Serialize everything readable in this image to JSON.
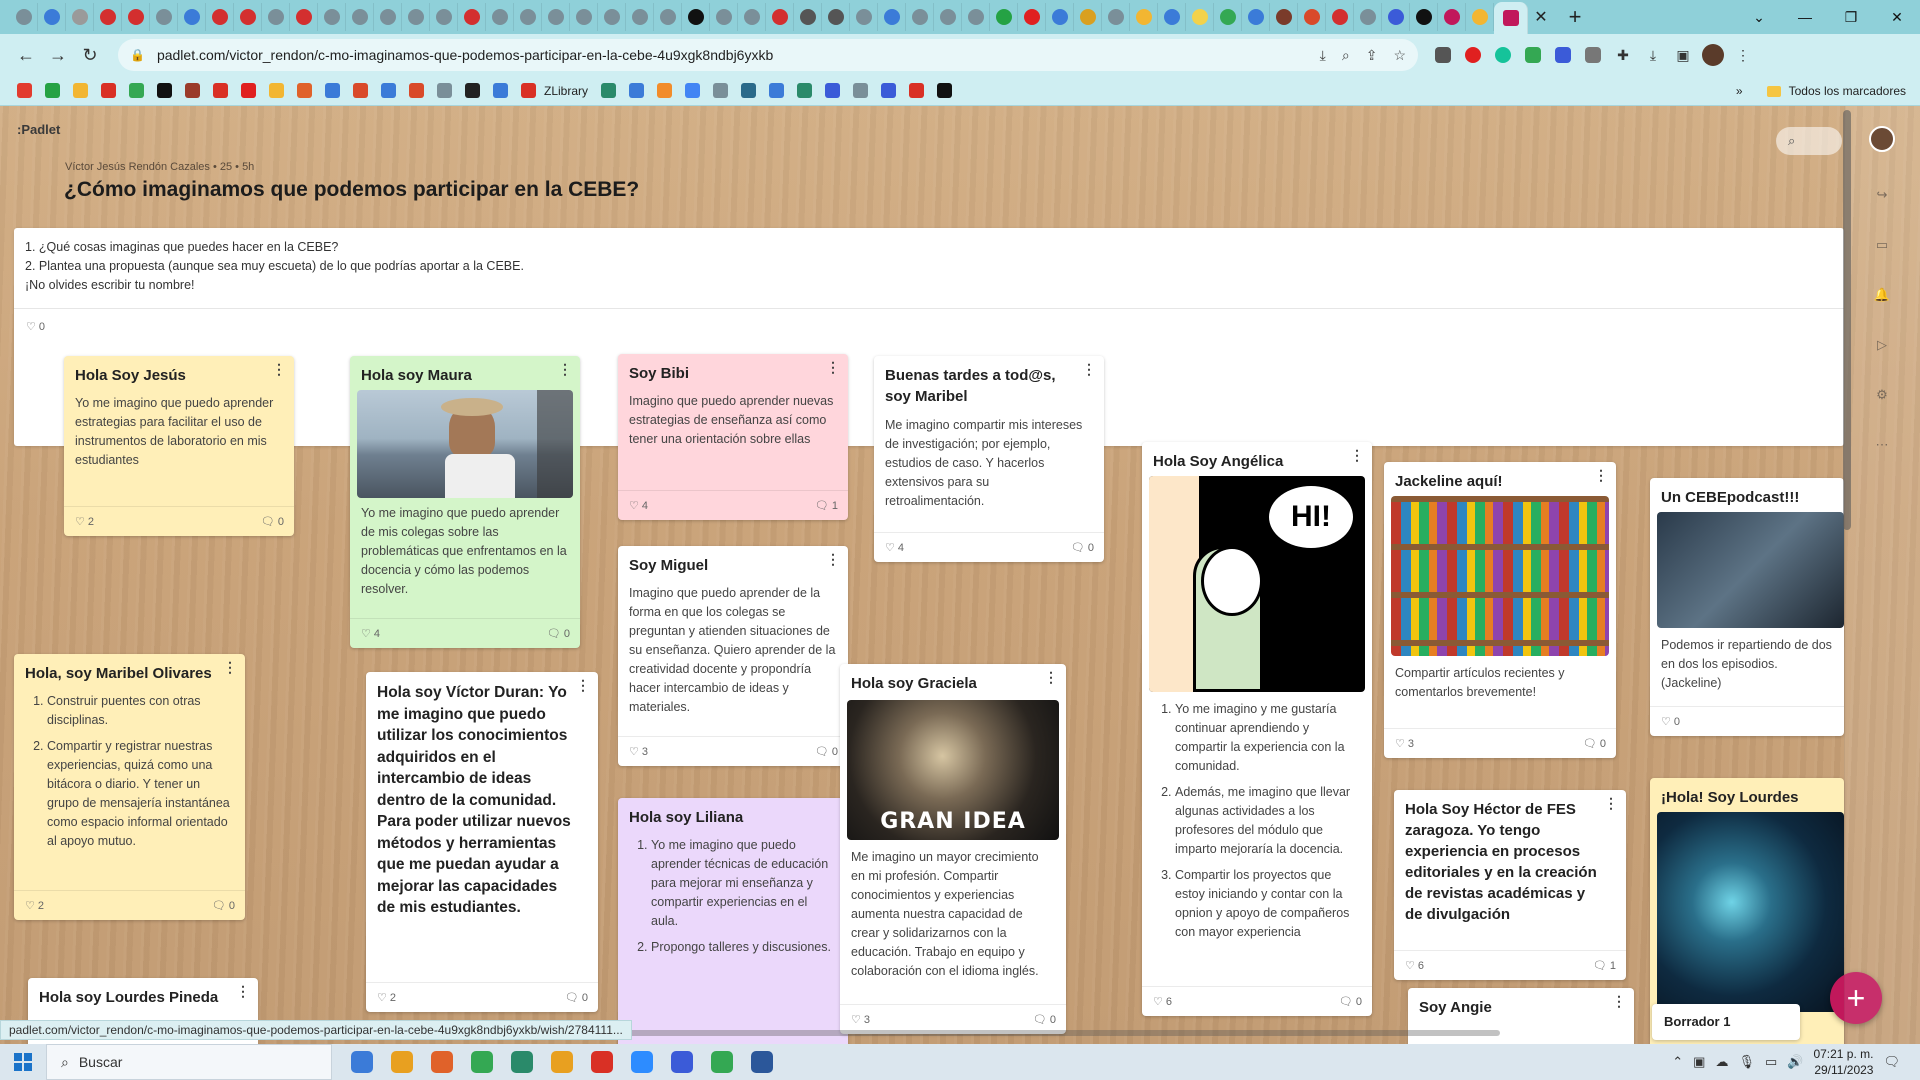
{
  "browser": {
    "url": "padlet.com/victor_rendon/c-mo-imaginamos-que-podemos-participar-en-la-cebe-4u9xgk8ndbj6yxkb",
    "tab_colors": [
      "#7a8f99",
      "#3b7bd8",
      "#9a9a9a",
      "#d32f2f",
      "#d32f2f",
      "#7a8f99",
      "#3b7bd8",
      "#d32f2f",
      "#d32f2f",
      "#7a8f99",
      "#d32f2f",
      "#7a8f99",
      "#7a8f99",
      "#7a8f99",
      "#7a8f99",
      "#7a8f99",
      "#d32f2f",
      "#7a8f99",
      "#7a8f99",
      "#7a8f99",
      "#7a8f99",
      "#7a8f99",
      "#7a8f99",
      "#7a8f99",
      "#111111",
      "#7a8f99",
      "#7a8f99",
      "#d32f2f",
      "#555555",
      "#555555",
      "#7a8f99",
      "#3b7bd8",
      "#7a8f99",
      "#7a8f99",
      "#7a8f99",
      "#25a244",
      "#e02020",
      "#3b7bd8",
      "#d9a020",
      "#7a8f99",
      "#f2b632",
      "#3b7bd8",
      "#f2d24a",
      "#34a853",
      "#3b7bd8",
      "#7a3b2a",
      "#d94a2a",
      "#d32f2f",
      "#7a8f99",
      "#3b5bd8",
      "#111111",
      "#c1185b",
      "#f2b632"
    ],
    "bookmarks_label": "ZLibrary",
    "all_bookmarks": "Todos los marcadores",
    "bm_colors": [
      "#e23b2e",
      "#25a244",
      "#f2b632",
      "#d93025",
      "#34a853",
      "#111111",
      "#9a3b2a",
      "#d93025",
      "#e02020",
      "#f2b632",
      "#e0622a",
      "#3b7bd8",
      "#d94a2a",
      "#3b7bd8",
      "#d94a2a",
      "#7a8f99",
      "#222222",
      "#3b7bd8",
      "#d93025",
      "#2a8a6a",
      "#3b7bd8",
      "#f28c2a",
      "#4285f4",
      "#7a8f99",
      "#2a6a8a",
      "#3b7bd8",
      "#2a8a6a",
      "#3b5bd8",
      "#7a8f99",
      "#3b5bd8",
      "#d93025",
      "#111111"
    ]
  },
  "padlet": {
    "brand": ":Padlet",
    "byline": "Víctor Jesús Rendón Cazales • 25 • 5h",
    "title": "¿Cómo imaginamos que podemos participar en la CEBE?",
    "description": {
      "line1": "1. ¿Qué cosas imaginas que puedes hacer en la CEBE?",
      "line2": "2. Plantea una propuesta (aunque sea muy escueta) de lo que podrías aportar a la CEBE.",
      "line3": "¡No olvides escribir tu nombre!",
      "likes": "♡ 0"
    },
    "posts": {
      "jesus": {
        "title": "Hola Soy Jesús",
        "body": "Yo me imagino que puedo aprender estrategias para facilitar el uso de instrumentos de laboratorio en mis estudiantes",
        "likes": "♡ 2",
        "comments": "🗨 0"
      },
      "maura": {
        "title": "Hola soy Maura",
        "body": "Yo me imagino que puedo aprender de mis colegas sobre las problemáticas que enfrentamos en la docencia y cómo las podemos resolver.",
        "likes": "♡ 4",
        "comments": "🗨 0"
      },
      "bibi": {
        "title": "Soy Bibi",
        "body": "Imagino que puedo aprender nuevas estrategias de enseñanza así como tener una orientación sobre ellas",
        "likes": "♡ 4",
        "comments": "🗨 1"
      },
      "maribel": {
        "title": "Buenas tardes a tod@s, soy Maribel",
        "body": "Me imagino compartir mis intereses de investigación; por ejemplo, estudios de caso. Y hacerlos extensivos para su retroalimentación.",
        "likes": "♡ 4",
        "comments": "🗨 0"
      },
      "angelica": {
        "title": "Hola  Soy Angélica",
        "items": [
          "Yo me imagino y me gustaría continuar aprendiendo y compartir la experiencia con la comunidad.",
          "Además, me imagino que llevar algunas actividades a los profesores del módulo que imparto mejoraría la docencia.",
          "Compartir los proyectos que estoy iniciando y contar con la opnion y apoyo de compañeros con mayor experiencia"
        ],
        "likes": "♡ 6",
        "comments": "🗨 0"
      },
      "jackeline": {
        "title": "Jackeline aquí!",
        "body": "Compartir artículos recientes y comentarlos  brevemente!",
        "likes": "♡ 3",
        "comments": "🗨 0"
      },
      "podcast": {
        "title": "Un CEBEpodcast!!!",
        "body": "Podemos ir repartiendo de dos en dos los episodios. (Jackeline)",
        "likes": "♡ 0"
      },
      "maribelo": {
        "title": "Hola, soy Maribel Olivares",
        "items": [
          "Construir puentes con otras disciplinas.",
          "Compartir y registrar nuestras experiencias, quizá como una bitácora o diario. Y tener un grupo de mensajería instantánea como espacio informal orientado al apoyo mutuo."
        ],
        "likes": "♡ 2",
        "comments": "🗨 0"
      },
      "victor": {
        "title": "Hola soy Víctor Duran:",
        "body": "Yo me imagino que puedo utilizar los conocimientos adquiridos en el intercambio de ideas dentro de la comunidad. Para poder utilizar nuevos métodos y herramientas que me puedan ayudar a mejorar las capacidades de mis estudiantes.",
        "likes": "♡ 2",
        "comments": "🗨 0"
      },
      "miguel": {
        "title": "Soy Miguel",
        "body": "Imagino que puedo aprender de la forma en que los colegas se preguntan y atienden situaciones de su enseñanza. Quiero aprender de la creatividad docente y propondría hacer intercambio de ideas y materiales.",
        "likes": "♡ 3",
        "comments": "🗨 0"
      },
      "graciela": {
        "title": "Hola soy Graciela",
        "img_caption": "GRAN IDEA",
        "body": "Me imagino un mayor crecimiento en mi profesión. Compartir conocimientos y experiencias aumenta nuestra capacidad de crear y solidarizarnos con la educación.  Trabajo en equipo y colaboración con el idioma inglés.",
        "likes": "♡ 3",
        "comments": "🗨 0"
      },
      "liliana": {
        "title": "Hola soy Liliana",
        "items": [
          "Yo me imagino que puedo aprender técnicas de educación para mejorar mi enseñanza y compartir experiencias en el aula.",
          "Propongo talleres y discusiones."
        ]
      },
      "hector": {
        "title": "Hola Soy Héctor de FES zaragoza. Yo tengo experiencia en procesos editoriales y en la creación de revistas académicas y de divulgación",
        "likes": "♡ 6",
        "comments": "🗨 1"
      },
      "lourdesr": {
        "title": "¡Hola! Soy Lourdes Reséndiz"
      },
      "lourdesp": {
        "title": "Hola soy Lourdes Pineda"
      },
      "angie": {
        "title": "Soy Angie"
      },
      "hi_bubble": "HI!"
    },
    "draft": "Borrador 1",
    "fab": "+",
    "status_url": "padlet.com/victor_rendon/c-mo-imaginamos-que-podemos-participar-en-la-cebe-4u9xgk8ndbj6yxkb/wish/2784111..."
  },
  "taskbar": {
    "search": "Buscar",
    "time": "07:21 p. m.",
    "date": "29/11/2023",
    "app_colors": [
      "#3b7bd8",
      "#e8a020",
      "#e0622a",
      "#34a853",
      "#2a8a6a",
      "#e8a020",
      "#d93025",
      "#2d8cff",
      "#3b5bd8",
      "#34a853",
      "#2b579a"
    ]
  }
}
